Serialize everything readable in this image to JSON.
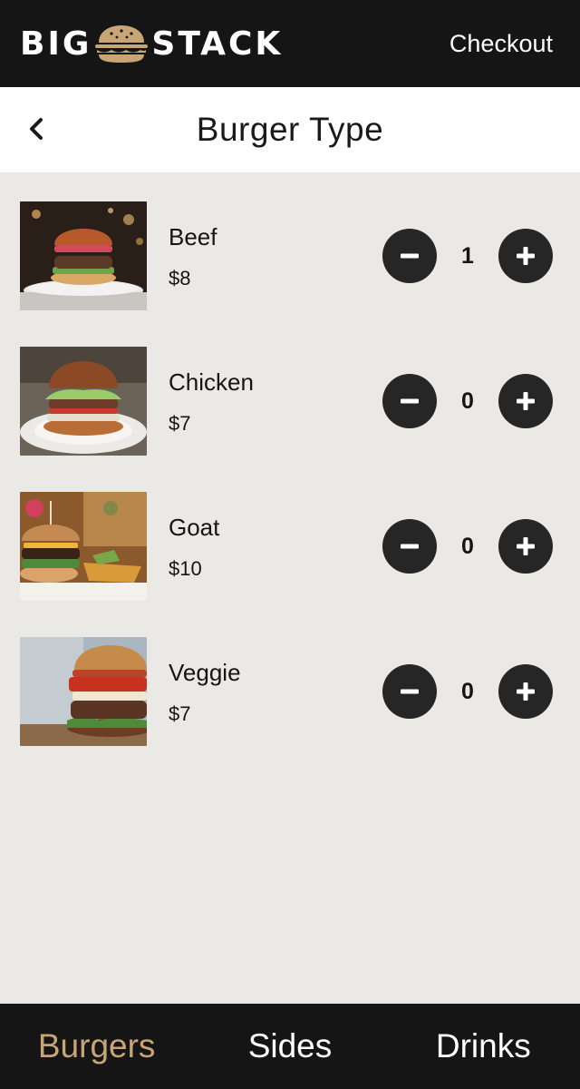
{
  "header": {
    "logo_left": "BIG",
    "logo_right": "STACK",
    "checkout_label": "Checkout"
  },
  "subheader": {
    "title": "Burger Type"
  },
  "items": [
    {
      "name": "Beef",
      "price": "$8",
      "quantity": "1"
    },
    {
      "name": "Chicken",
      "price": "$7",
      "quantity": "0"
    },
    {
      "name": "Goat",
      "price": "$10",
      "quantity": "0"
    },
    {
      "name": "Veggie",
      "price": "$7",
      "quantity": "0"
    }
  ],
  "nav": {
    "tabs": [
      {
        "label": "Burgers",
        "active": true
      },
      {
        "label": "Sides",
        "active": false
      },
      {
        "label": "Drinks",
        "active": false
      }
    ]
  },
  "colors": {
    "bar_background": "#151515",
    "page_background": "#ebe9e6",
    "accent_gold": "#c9a575",
    "button_dark": "#262626"
  },
  "icons": {
    "back": "chevron-left-icon",
    "minus": "minus-icon",
    "plus": "plus-icon",
    "logo": "burger-logo-icon"
  }
}
